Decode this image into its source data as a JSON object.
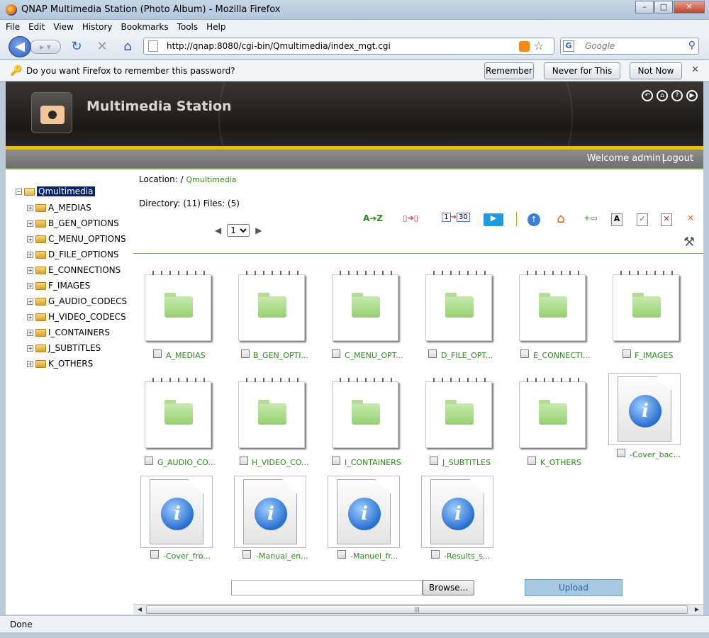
{
  "window": {
    "title": "QNAP Multimedia Station (Photo Album) - Mozilla Firefox",
    "min": "–",
    "max": "□",
    "close": "✕"
  },
  "menu": [
    "File",
    "Edit",
    "View",
    "History",
    "Bookmarks",
    "Tools",
    "Help"
  ],
  "nav": {
    "url": "http://qnap:8080/cgi-bin/Qmultimedia/index_mgt.cgi",
    "search_placeholder": "Google",
    "search_engine": "G"
  },
  "password_bar": {
    "message": "Do you want Firefox to remember this password?",
    "remember": "Remember",
    "never": "Never for This Site",
    "not_now": "Not Now"
  },
  "banner": {
    "brand": "Multimedia Station"
  },
  "header": {
    "welcome": "Welcome admin",
    "separator": "|",
    "logout": "Logout"
  },
  "location": {
    "label": "Location: /",
    "path": "Qmultimedia"
  },
  "dirinfo": "Directory: (11) Files: (5)",
  "pager": {
    "page": "1"
  },
  "tree": {
    "root": "Qmultimedia",
    "children": [
      "A_MEDIAS",
      "B_GEN_OPTIONS",
      "C_MENU_OPTIONS",
      "D_FILE_OPTIONS",
      "E_CONNECTIONS",
      "F_IMAGES",
      "G_AUDIO_CODECS",
      "H_VIDEO_CODECS",
      "I_CONTAINERS",
      "J_SUBTITLES",
      "K_OTHERS"
    ]
  },
  "toolbar": {
    "sort_az": "A➔Z",
    "date_range_from": "1",
    "date_range_to": "30"
  },
  "folders": [
    "A_MEDIAS",
    "B_GEN_OPTI...",
    "C_MENU_OPT...",
    "D_FILE_OPT...",
    "E_CONNECTI...",
    "F_IMAGES",
    "G_AUDIO_CO...",
    "H_VIDEO_CO...",
    "I_CONTAINERS",
    "J_SUBTITLES",
    "K_OTHERS"
  ],
  "files": [
    "-Cover_bac...",
    "-Cover_fro...",
    "-Manual_en...",
    "-Manuel_fr...",
    "-Results_s..."
  ],
  "upload": {
    "browse": "Browse...",
    "upload": "Upload"
  },
  "status": "Done"
}
